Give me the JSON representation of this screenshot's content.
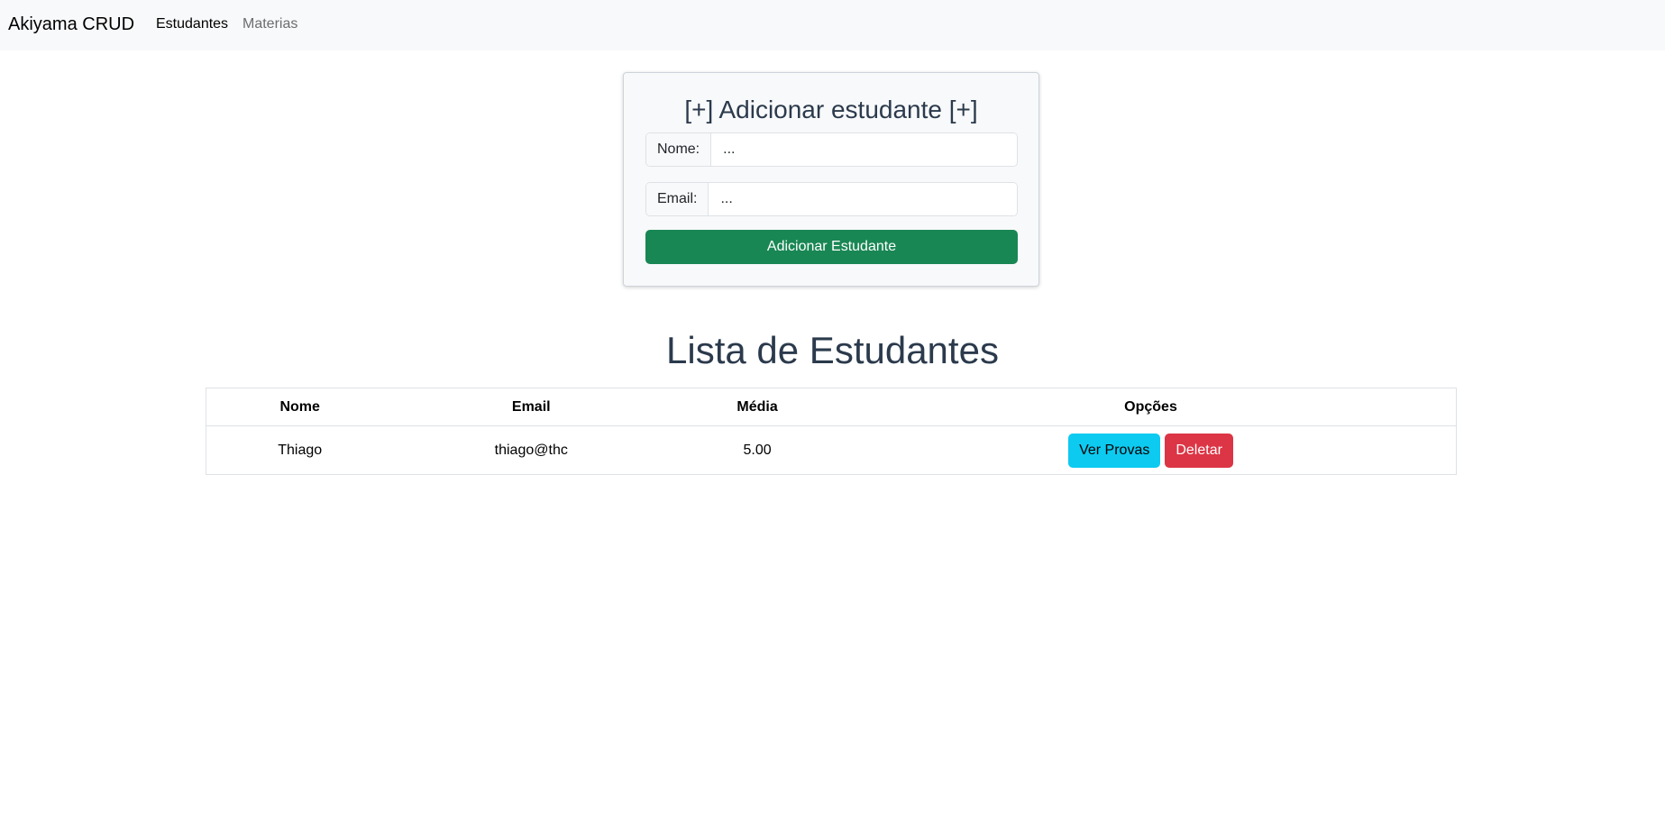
{
  "navbar": {
    "brand": "Akiyama CRUD",
    "links": [
      {
        "label": "Estudantes",
        "active": true
      },
      {
        "label": "Materias",
        "active": false
      }
    ]
  },
  "form": {
    "title": "[+] Adicionar estudante [+]",
    "nome_label": "Nome:",
    "nome_placeholder": "...",
    "email_label": "Email:",
    "email_placeholder": "...",
    "submit_label": "Adicionar Estudante"
  },
  "list": {
    "title": "Lista de Estudantes",
    "columns": [
      "Nome",
      "Email",
      "Média",
      "Opções"
    ],
    "rows": [
      {
        "nome": "Thiago",
        "email": "thiago@thc",
        "media": "5.00",
        "view_label": "Ver Provas",
        "delete_label": "Deletar"
      }
    ]
  },
  "colors": {
    "navbar_bg": "#f8f9fa",
    "success": "#198754",
    "info": "#0dcaf0",
    "danger": "#dc3545",
    "heading": "#2b3a4c"
  }
}
